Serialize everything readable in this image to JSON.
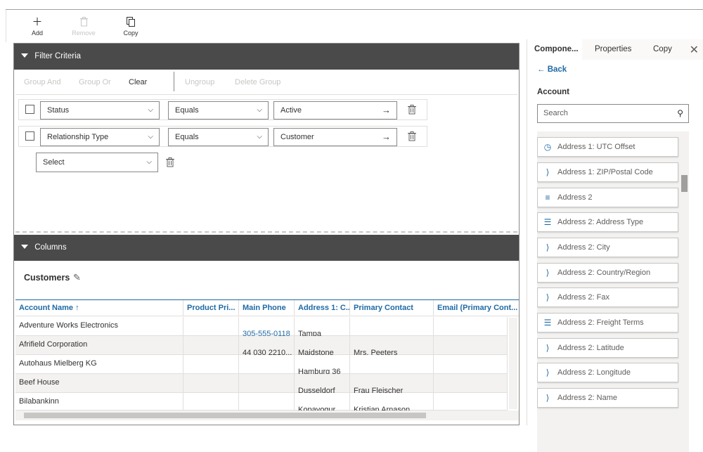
{
  "toolbar": {
    "add_label": "Add",
    "remove_label": "Remove",
    "copy_label": "Copy"
  },
  "filter": {
    "header": "Filter Criteria",
    "actions": {
      "group_and": "Group And",
      "group_or": "Group Or",
      "clear": "Clear",
      "ungroup": "Ungroup",
      "delete_group": "Delete Group"
    },
    "rows": [
      {
        "field": "Status",
        "operator": "Equals",
        "value": "Active"
      },
      {
        "field": "Relationship Type",
        "operator": "Equals",
        "value": "Customer"
      }
    ],
    "new_row_placeholder": "Select"
  },
  "columns": {
    "header": "Columns",
    "view_name": "Customers",
    "grid_headers": [
      "Account Name ↑",
      "Product Pri...",
      "Main Phone",
      "Address 1: C...",
      "Primary Contact",
      "Email (Primary Cont..."
    ],
    "rows": [
      [
        "Adventure Works Electronics",
        "",
        "",
        "",
        "",
        ""
      ],
      [
        "Afrifield Corporation",
        "",
        "305-555-0118",
        "Tampa",
        "",
        ""
      ],
      [
        "Autohaus Mielberg KG",
        "",
        "44 030 2210...",
        "Maidstone",
        "Mrs. Peeters",
        ""
      ],
      [
        "Beef House",
        "",
        "",
        "Hamburg 36",
        "",
        ""
      ],
      [
        "Bilabankinn",
        "",
        "",
        "Dusseldorf",
        "Frau Fleischer",
        ""
      ],
      [
        "",
        "",
        "",
        "Kopavogur",
        "Kristian Arnason",
        ""
      ]
    ]
  },
  "right_panel": {
    "tabs": [
      "Compone...",
      "Properties",
      "Copy"
    ],
    "back_label": "Back",
    "entity_title": "Account",
    "search_placeholder": "Search",
    "fields": [
      {
        "label": "Address 1: UTC Offset",
        "icon": "clock-icon"
      },
      {
        "label": "Address 1: ZIP/Postal Code",
        "icon": "text-field-icon"
      },
      {
        "label": "Address 2",
        "icon": "multiline-icon"
      },
      {
        "label": "Address 2: Address Type",
        "icon": "option-set-icon"
      },
      {
        "label": "Address 2: City",
        "icon": "text-field-icon"
      },
      {
        "label": "Address 2: Country/Region",
        "icon": "text-field-icon"
      },
      {
        "label": "Address 2: Fax",
        "icon": "text-field-icon"
      },
      {
        "label": "Address 2: Freight Terms",
        "icon": "option-set-icon"
      },
      {
        "label": "Address 2: Latitude",
        "icon": "text-field-icon"
      },
      {
        "label": "Address 2: Longitude",
        "icon": "text-field-icon"
      },
      {
        "label": "Address 2: Name",
        "icon": "text-field-icon"
      }
    ]
  },
  "colors": {
    "accent": "#1f6aa5",
    "section_header": "#4a4a4a"
  }
}
